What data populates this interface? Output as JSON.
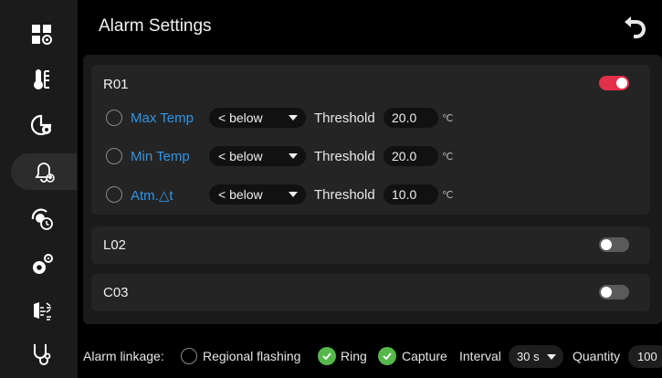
{
  "header": {
    "title": "Alarm Settings",
    "back_icon": "back-arrow-icon"
  },
  "sidebar": {
    "items": [
      {
        "name": "dashboard-icon"
      },
      {
        "name": "thermometer-icon"
      },
      {
        "name": "region-settings-icon"
      },
      {
        "name": "alarm-settings-icon",
        "active": true
      },
      {
        "name": "schedule-icon"
      },
      {
        "name": "system-settings-icon"
      },
      {
        "name": "detection-icon"
      },
      {
        "name": "health-icon"
      }
    ]
  },
  "regions": [
    {
      "name": "R01",
      "enabled": true,
      "rows": [
        {
          "label": "Max Temp",
          "condition": "< below",
          "threshold_label": "Threshold",
          "value": "20.0",
          "unit": "℃"
        },
        {
          "label": "Min Temp",
          "condition": "< below",
          "threshold_label": "Threshold",
          "value": "20.0",
          "unit": "℃"
        },
        {
          "label": "Atm.△t",
          "condition": "< below",
          "threshold_label": "Threshold",
          "value": "10.0",
          "unit": "℃"
        }
      ]
    },
    {
      "name": "L02",
      "enabled": false
    },
    {
      "name": "C03",
      "enabled": false
    }
  ],
  "linkage": {
    "label": "Alarm linkage:",
    "regional_flashing": {
      "label": "Regional flashing",
      "checked": false
    },
    "ring": {
      "label": "Ring",
      "checked": true
    },
    "capture": {
      "label": "Capture",
      "checked": true
    },
    "interval_label": "Interval",
    "interval_value": "30 s",
    "quantity_label": "Quantity",
    "quantity_value": "100"
  },
  "colors": {
    "accent": "#e2304a",
    "link": "#2f95e8",
    "check": "#56b84a"
  }
}
